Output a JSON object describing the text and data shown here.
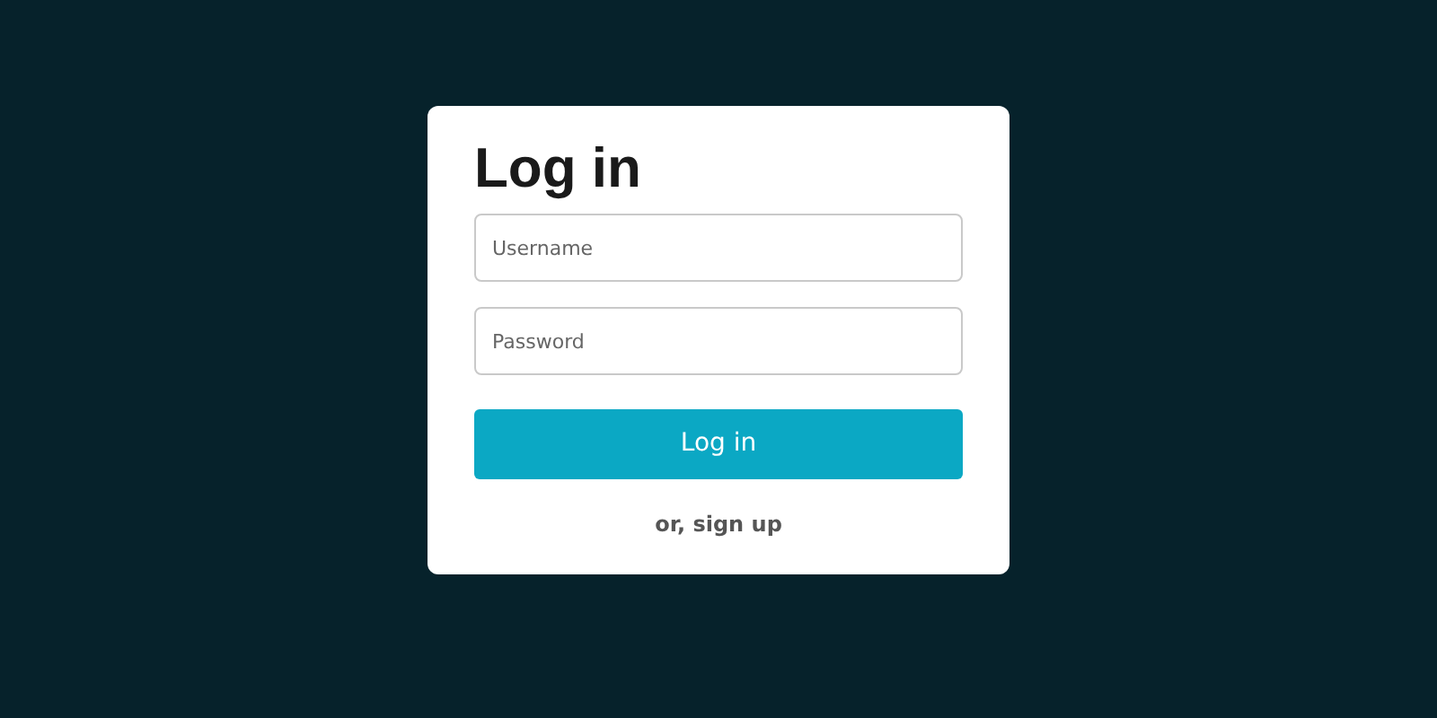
{
  "title": "Log in",
  "fields": [
    {
      "placeholder": "Username"
    },
    {
      "placeholder": "Password"
    }
  ],
  "submit": "Log in",
  "signup_link": "or, sign up"
}
